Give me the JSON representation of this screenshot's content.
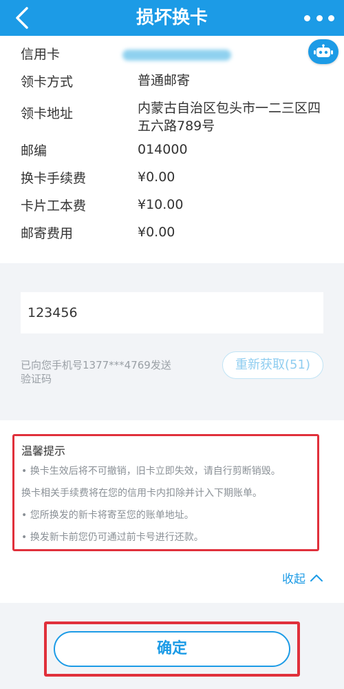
{
  "header": {
    "title": "损坏换卡",
    "back_icon": "chevron-left-icon",
    "more_icon": "more-dots-icon"
  },
  "info": {
    "rows": [
      {
        "label": "信用卡",
        "value": ""
      },
      {
        "label": "领卡方式",
        "value": "普通邮寄"
      },
      {
        "label": "领卡地址",
        "value": "内蒙古自治区包头市一二三区四五六路789号"
      },
      {
        "label": "邮编",
        "value": "014000"
      },
      {
        "label": "换卡手续费",
        "value": "¥0.00"
      },
      {
        "label": "卡片工本费",
        "value": "¥10.00"
      },
      {
        "label": "邮寄费用",
        "value": "¥0.00"
      }
    ],
    "assistant_icon": "robot-icon"
  },
  "verification": {
    "code_value": "123456",
    "sent_note": "已向您手机号1377***4769发送验证码",
    "resend_label": "重新获取(51)"
  },
  "tips": {
    "title": "温馨提示",
    "items": [
      "• 换卡生效后将不可撤销，旧卡立即失效，请自行剪断销毁。",
      "换卡相关手续费将在您的信用卡内扣除并计入下期账单。",
      "• 您所换发的新卡将寄至您的账单地址。",
      "• 换发新卡前您仍可通过前卡号进行还款。"
    ],
    "collapse_label": "收起"
  },
  "footer": {
    "confirm_label": "确定"
  },
  "colors": {
    "brand": "#1c9be6",
    "highlight": "#e0303b"
  }
}
